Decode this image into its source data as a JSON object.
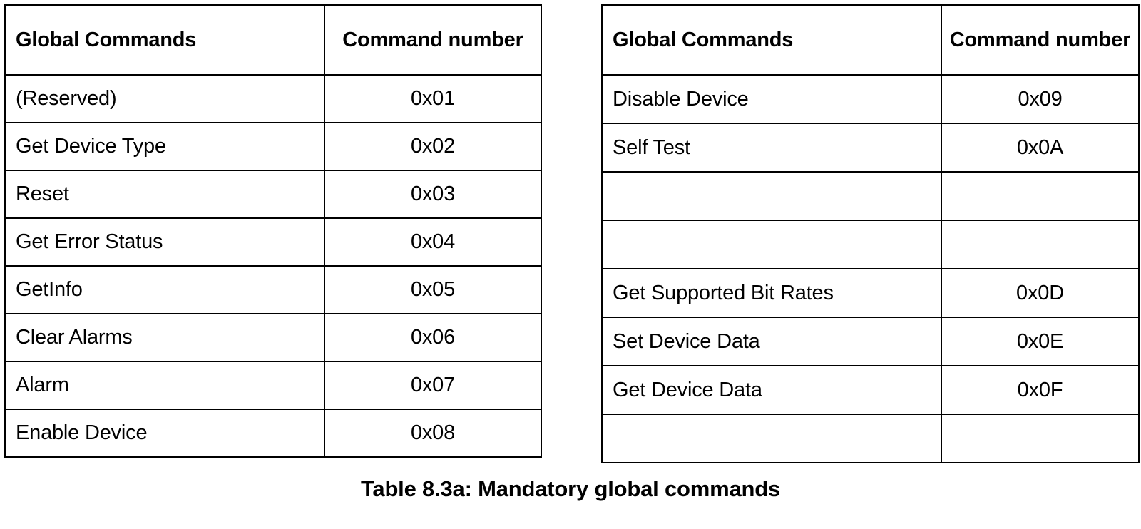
{
  "caption": "Table 8.3a: Mandatory global commands",
  "tables": [
    {
      "id": "left",
      "columns": {
        "name": "Global Commands",
        "number": "Command number"
      },
      "rows": [
        {
          "name": "(Reserved)",
          "number": "0x01"
        },
        {
          "name": "Get Device Type",
          "number": "0x02"
        },
        {
          "name": "Reset",
          "number": "0x03"
        },
        {
          "name": "Get Error Status",
          "number": "0x04"
        },
        {
          "name": "GetInfo",
          "number": "0x05"
        },
        {
          "name": "Clear Alarms",
          "number": "0x06"
        },
        {
          "name": "Alarm",
          "number": "0x07"
        },
        {
          "name": "Enable Device",
          "number": "0x08"
        }
      ]
    },
    {
      "id": "right",
      "columns": {
        "name": "Global Commands",
        "number": "Command number"
      },
      "rows": [
        {
          "name": "Disable Device",
          "number": "0x09"
        },
        {
          "name": "Self Test",
          "number": "0x0A"
        },
        {
          "name": "",
          "number": ""
        },
        {
          "name": "",
          "number": ""
        },
        {
          "name": "Get Supported Bit Rates",
          "number": "0x0D"
        },
        {
          "name": "Set Device Data",
          "number": "0x0E"
        },
        {
          "name": "Get Device Data",
          "number": "0x0F"
        },
        {
          "name": "",
          "number": ""
        }
      ]
    }
  ]
}
